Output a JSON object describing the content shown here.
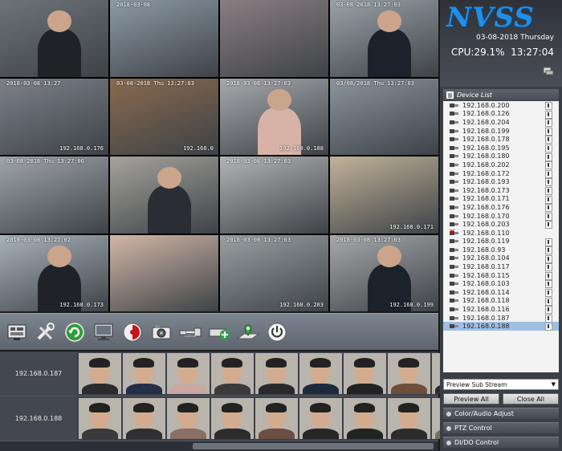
{
  "camera_grid": {
    "tiles": [
      {
        "timestamp": "",
        "ip": "",
        "scene": "#6e7378"
      },
      {
        "timestamp": "2018-03-08",
        "ip": "",
        "scene": "#8d9aa6"
      },
      {
        "timestamp": "",
        "ip": "",
        "scene": "#8a7e82"
      },
      {
        "timestamp": "03-08-2018  13:27:03",
        "ip": "",
        "scene": "#9aa3a8"
      },
      {
        "timestamp": "2018-03-08  13:27",
        "ip": "192.168.0.176",
        "scene": "#7c8288"
      },
      {
        "timestamp": "03-08-2018 Thu 13:27:03",
        "ip": "192.168.0",
        "scene": "#8a6a4e"
      },
      {
        "timestamp": "2018-03-08 13:27:03",
        "ip": "192.168.0.188",
        "scene": "#a7a9ad"
      },
      {
        "timestamp": "03/08/2018 Thu 13:27:03",
        "ip": "",
        "scene": "#8b949d"
      },
      {
        "timestamp": "03-08-2018 Thu 13:27:06",
        "ip": "",
        "scene": "#9fa5aa"
      },
      {
        "timestamp": "",
        "ip": "",
        "scene": "#a5a39c"
      },
      {
        "timestamp": "2018-03-08 13:27:03",
        "ip": "",
        "scene": "#b3b5b6"
      },
      {
        "timestamp": "",
        "ip": "192.168.0.171",
        "scene": "#c2b39a"
      },
      {
        "timestamp": "2018-03-08 13:27:02",
        "ip": "192.168.0.173",
        "scene": "#a9b3bb"
      },
      {
        "timestamp": "",
        "ip": "",
        "scene": "#d2b7a8"
      },
      {
        "timestamp": "2018-03-08 13:27:03",
        "ip": "192.168.0.203",
        "scene": "#9aa0a3"
      },
      {
        "timestamp": "2018-03-08 13:27:03",
        "ip": "192.168.0.199",
        "scene": "#a7a9ab"
      }
    ]
  },
  "toolbar": {
    "buttons": [
      "device-config-button",
      "tools-button",
      "refresh-button",
      "monitor-button",
      "record-button",
      "snapshot-button",
      "network-button",
      "add-device-button",
      "map-button",
      "power-button"
    ]
  },
  "preview_rows": [
    {
      "label": "192.168.0.187",
      "bodies": [
        "#2b2b2b",
        "#24304a",
        "#c9a7a2",
        "#3b3b3b",
        "#2a2a2a",
        "#1d2a3e",
        "#222",
        "#6d4f3b",
        "#2e2e2e"
      ]
    },
    {
      "label": "192.168.0.188",
      "bodies": [
        "#3a3a3a",
        "#2f2f2f",
        "#8a6f66",
        "#2b2b2b",
        "#6b4e44",
        "#262626",
        "#222",
        "#2c2c2c",
        "#7b6b5e"
      ]
    }
  ],
  "panel": {
    "logo": "NVSS",
    "date": "03-08-2018  Thursday",
    "cpu": "CPU:29.1%",
    "time": "13:27:04",
    "device_list_title": "Device List",
    "devices": [
      {
        "ip": "192.168.0.200",
        "status": "online"
      },
      {
        "ip": "192.168.0.126",
        "status": "online"
      },
      {
        "ip": "192.168.0.204",
        "status": "online"
      },
      {
        "ip": "192.168.0.199",
        "status": "online"
      },
      {
        "ip": "192.168.0.178",
        "status": "online"
      },
      {
        "ip": "192.168.0.195",
        "status": "online"
      },
      {
        "ip": "192.168.0.180",
        "status": "online"
      },
      {
        "ip": "192.168.0.202",
        "status": "online"
      },
      {
        "ip": "192.168.0.172",
        "status": "online"
      },
      {
        "ip": "192.168.0.193",
        "status": "online"
      },
      {
        "ip": "192.168.0.173",
        "status": "online"
      },
      {
        "ip": "192.168.0.171",
        "status": "online"
      },
      {
        "ip": "192.168.0.176",
        "status": "online"
      },
      {
        "ip": "192.168.0.170",
        "status": "online"
      },
      {
        "ip": "192.168.0.203",
        "status": "online"
      },
      {
        "ip": "192.168.0.110",
        "status": "offline"
      },
      {
        "ip": "192.168.0.119",
        "status": "online"
      },
      {
        "ip": "192.168.0.93",
        "status": "online"
      },
      {
        "ip": "192.168.0.104",
        "status": "online"
      },
      {
        "ip": "192.168.0.117",
        "status": "online"
      },
      {
        "ip": "192.168.0.115",
        "status": "online"
      },
      {
        "ip": "192.168.0.103",
        "status": "online"
      },
      {
        "ip": "192.168.0.114",
        "status": "online"
      },
      {
        "ip": "192.168.0.118",
        "status": "online"
      },
      {
        "ip": "192.168.0.116",
        "status": "online"
      },
      {
        "ip": "192.168.0.187",
        "status": "online"
      },
      {
        "ip": "192.168.0.188",
        "status": "selected"
      }
    ],
    "stream_select": "Preview Sub Stream",
    "preview_all": "Preview All",
    "close_all": "Close All",
    "sections": [
      "Color/Audio Adjust",
      "PTZ Control",
      "DI/DO Control"
    ]
  }
}
